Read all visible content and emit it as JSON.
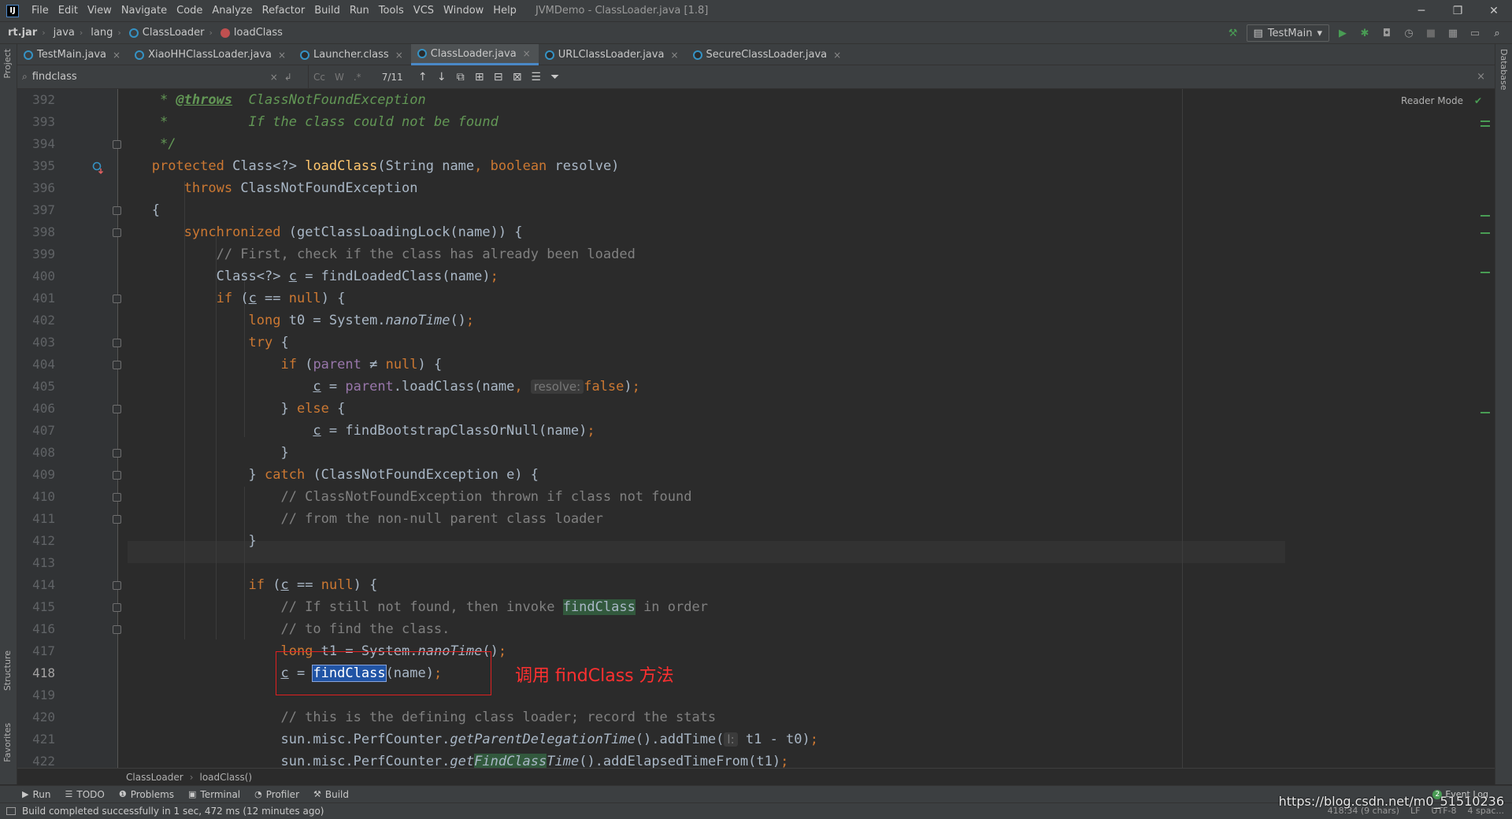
{
  "menubar": {
    "items": [
      "File",
      "Edit",
      "View",
      "Navigate",
      "Code",
      "Analyze",
      "Refactor",
      "Build",
      "Run",
      "Tools",
      "VCS",
      "Window",
      "Help"
    ],
    "window_title": "JVMDemo - ClassLoader.java [1.8]"
  },
  "navbar": {
    "crumbs": [
      "rt.jar",
      "java",
      "lang",
      "ClassLoader",
      "loadClass"
    ],
    "run_config": "TestMain"
  },
  "left_stripe": {
    "project": "Project",
    "structure": "Structure",
    "favorites": "Favorites"
  },
  "right_stripe": {
    "database": "Database"
  },
  "tabs": [
    {
      "label": "TestMain.java",
      "active": false
    },
    {
      "label": "XiaoHHClassLoader.java",
      "active": false
    },
    {
      "label": "Launcher.class",
      "active": false
    },
    {
      "label": "ClassLoader.java",
      "active": true
    },
    {
      "label": "URLClassLoader.java",
      "active": false
    },
    {
      "label": "SecureClassLoader.java",
      "active": false
    }
  ],
  "find": {
    "query": "findclass",
    "match_case": "Cc",
    "words": "W",
    "regex": ".*",
    "match_count": "7/11"
  },
  "editor": {
    "reader_mode": "Reader Mode",
    "line_numbers": [
      "392",
      "393",
      "394",
      "395",
      "396",
      "397",
      "398",
      "399",
      "400",
      "401",
      "402",
      "403",
      "404",
      "405",
      "406",
      "407",
      "408",
      "409",
      "410",
      "411",
      "412",
      "413",
      "414",
      "415",
      "416",
      "417",
      "418",
      "419",
      "420",
      "421",
      "422"
    ],
    "current_line": "418",
    "code": {
      "l392_tag": "@throws",
      "l392_rest": "  ClassNotFoundException",
      "l393": "*          If the class could not be found",
      "l394": "*/",
      "l395_kw": "protected",
      "l395_a": " Class<?> ",
      "l395_fn": "loadClass",
      "l395_b": "(String name",
      "l395_c": ", ",
      "l395_kw2": "boolean",
      "l395_d": " resolve)",
      "l396_kw": "throws",
      "l396_rest": " ClassNotFoundException",
      "l397": "{",
      "l398_kw": "synchronized",
      "l398_rest": " (getClassLoadingLock(name)) {",
      "l399": "// First, check if the class has already been loaded",
      "l400_a": "Class<?> ",
      "l400_c": "c",
      "l400_b": " = findLoadedClass(name)",
      "l400_semi": ";",
      "l401_kw": "if",
      "l401_a": " (",
      "l401_c": "c",
      "l401_b": " == ",
      "l401_null": "null",
      "l401_d": ") {",
      "l402_kw": "long",
      "l402_a": " t0 = System.",
      "l402_it": "nanoTime",
      "l402_b": "()",
      "l402_semi": ";",
      "l403_kw": "try",
      "l403_b": " {",
      "l404_kw": "if",
      "l404_a": " (",
      "l404_field": "parent",
      "l404_b": " ≠ ",
      "l404_null": "null",
      "l404_c": ") {",
      "l405_c": "c",
      "l405_a": " = ",
      "l405_field": "parent",
      "l405_b": ".loadClass(name",
      "l405_comma": ", ",
      "l405_hint": "resolve:",
      "l405_false": "false",
      "l405_end": ")",
      "l405_semi": ";",
      "l406_a": "} ",
      "l406_kw": "else",
      "l406_b": " {",
      "l407_c": "c",
      "l407_a": " = findBootstrapClassOrNull(name)",
      "l407_semi": ";",
      "l408": "}",
      "l409_a": "} ",
      "l409_kw": "catch",
      "l409_b": " (ClassNotFoundException e) {",
      "l410": "// ClassNotFoundException thrown if class not found",
      "l411": "// from the non-null parent class loader",
      "l412": "}",
      "l414_kw": "if",
      "l414_a": " (",
      "l414_c": "c",
      "l414_b": " == ",
      "l414_null": "null",
      "l414_d": ") {",
      "l415_a": "// If still not found, then invoke ",
      "l415_match": "findClass",
      "l415_b": " in order",
      "l416": "// to find the class.",
      "l417_kw": "long",
      "l417_a": " t1 = System.",
      "l417_it": "nanoTime",
      "l417_b": "()",
      "l417_semi": ";",
      "l418_c": "c",
      "l418_a": " = ",
      "l418_match": "findClass",
      "l418_b": "(name)",
      "l418_semi": ";",
      "l420": "// this is the defining class loader; record the stats",
      "l421_a": "sun.misc.PerfCounter.",
      "l421_it": "getParentDelegationTime",
      "l421_b": "().addTime(",
      "l421_hint": "l:",
      "l421_c": " t1 - t0)",
      "l421_semi": ";",
      "l422_a": "sun.misc.PerfCounter.",
      "l422_it1": "get",
      "l422_match": "FindClass",
      "l422_it2": "Time",
      "l422_b": "().addElapsedTimeFrom(t1)",
      "l422_semi": ";"
    }
  },
  "annotation": {
    "text": "调用 findClass 方法"
  },
  "editor_crumbs": [
    "ClassLoader",
    "loadClass()"
  ],
  "tool_windows": [
    {
      "icon": "▶",
      "label": "Run"
    },
    {
      "icon": "☰",
      "label": "TODO"
    },
    {
      "icon": "❶",
      "label": "Problems"
    },
    {
      "icon": "▣",
      "label": "Terminal"
    },
    {
      "icon": "◔",
      "label": "Profiler"
    },
    {
      "icon": "⚒",
      "label": "Build"
    }
  ],
  "event_log": {
    "count": "2",
    "label": "Event Log"
  },
  "status": {
    "message": "Build completed successfully in 1 sec, 472 ms (12 minutes ago)",
    "position": "418:34 (9 chars)",
    "line_sep": "LF",
    "encoding": "UTF-8",
    "indent": "4 spac..."
  },
  "watermark": "https://blog.csdn.net/m0_51510236"
}
